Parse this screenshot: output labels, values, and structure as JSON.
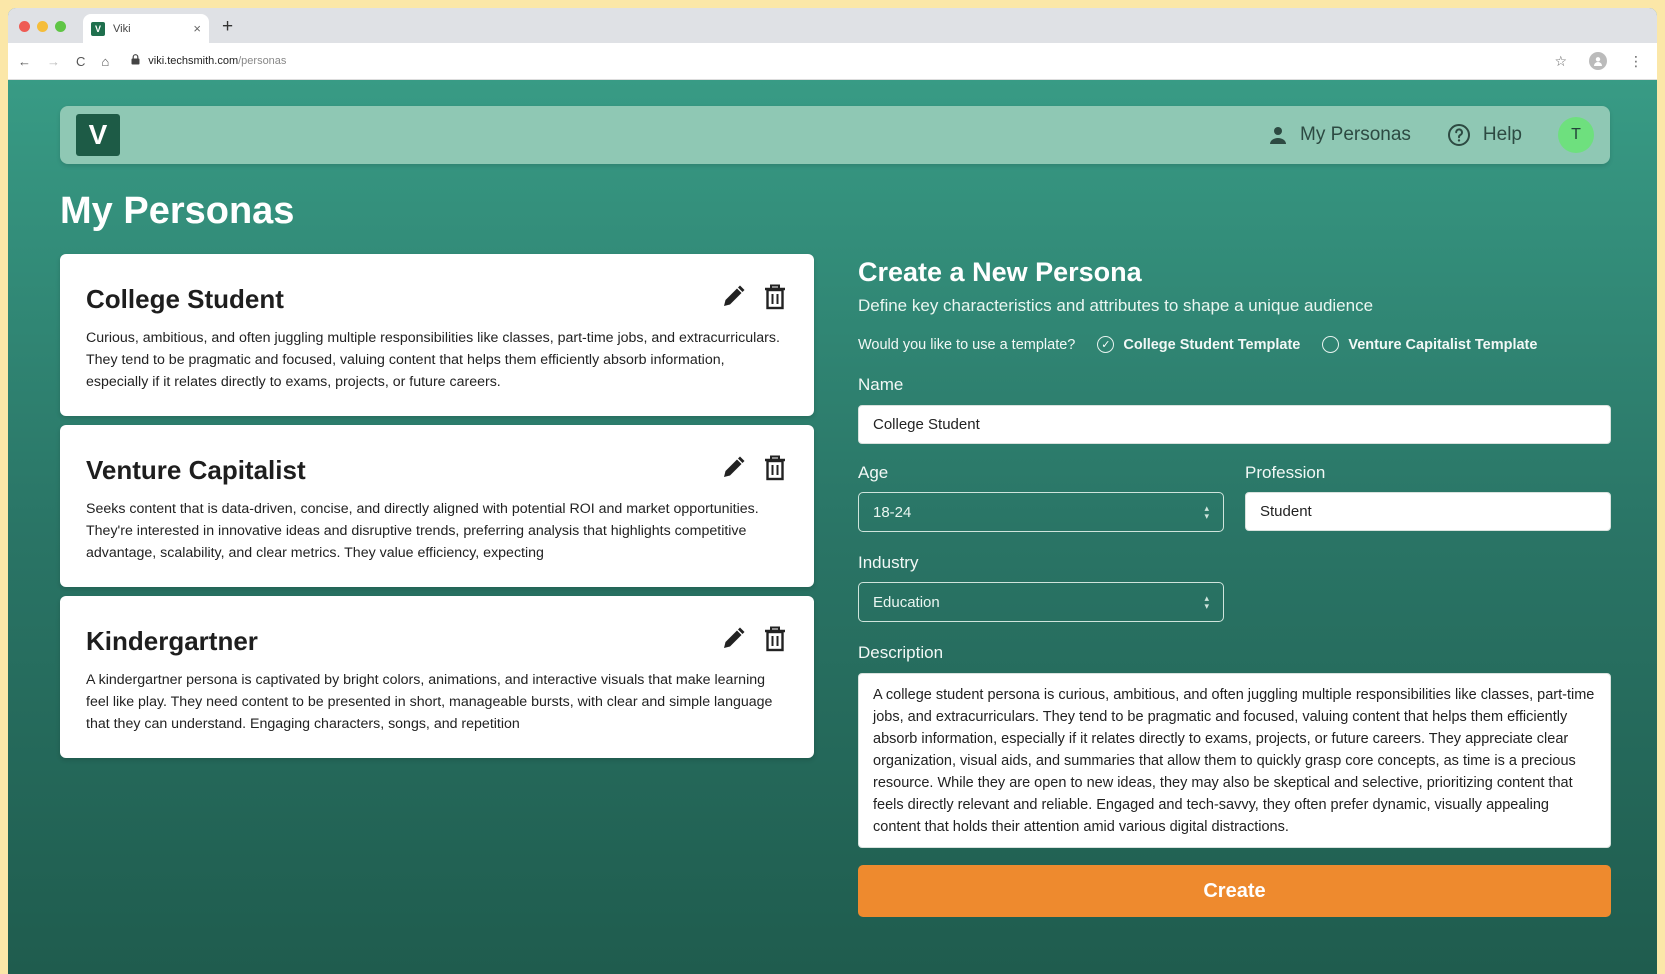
{
  "browser": {
    "tab_title": "Viki",
    "tab_favicon": "V",
    "tab_close": "×",
    "new_tab": "+",
    "url_host": "viki.techsmith.com",
    "url_path": "/personas",
    "nav": {
      "back": "←",
      "forward": "→",
      "reload": "C",
      "home": "⌂"
    },
    "star": "☆",
    "menu": "⋮"
  },
  "app": {
    "logo": "V",
    "nav": {
      "my_personas": "My Personas",
      "help": "Help",
      "avatar_initial": "T"
    },
    "page_title": "My Personas",
    "personas": [
      {
        "title": "College Student",
        "description": "Curious, ambitious, and often juggling multiple responsibilities like classes, part-time jobs, and extracurriculars. They tend to be pragmatic and focused, valuing content that helps them efficiently absorb information, especially if it relates directly to exams, projects, or future careers."
      },
      {
        "title": "Venture Capitalist",
        "description": "Seeks content that is data-driven, concise, and directly aligned with potential ROI and market opportunities. They're interested in innovative ideas and disruptive trends, preferring analysis that highlights competitive advantage, scalability, and clear metrics. They value efficiency, expecting"
      },
      {
        "title": "Kindergartner",
        "description": "A kindergartner persona is captivated by bright colors, animations, and interactive visuals that make learning feel like play. They need content to be presented in short, manageable bursts, with clear and simple language that they can understand. Engaging characters, songs, and repetition"
      }
    ],
    "form": {
      "title": "Create a New Persona",
      "subtitle": "Define key characteristics and attributes to shape a unique audience",
      "template_question": "Would you like to use a template?",
      "template_options": [
        "College Student Template",
        "Venture Capitalist Template"
      ],
      "template_selected": "College Student Template",
      "name_label": "Name",
      "name_value": "College Student",
      "age_label": "Age",
      "age_value": "18-24",
      "profession_label": "Profession",
      "profession_value": "Student",
      "industry_label": "Industry",
      "industry_value": "Education",
      "description_label": "Description",
      "description_value": "A college student persona is curious, ambitious, and often juggling multiple responsibilities like classes, part-time jobs, and extracurriculars. They tend to be pragmatic and focused, valuing content that helps them efficiently absorb information, especially if it relates directly to exams, projects, or future careers. They appreciate clear organization, visual aids, and summaries that allow them to quickly grasp core concepts, as time is a precious resource. While they are open to new ideas, they may also be skeptical and selective, prioritizing content that feels directly relevant and reliable. Engaged and tech-savvy, they often prefer dynamic, visually appealing content that holds their attention amid various digital distractions.",
      "create_label": "Create"
    }
  },
  "colors": {
    "brand": "#1d5b46",
    "accent": "#ee8a2e",
    "avatar": "#6ee07e",
    "navbar": "#8fc8b4",
    "background_top": "#389b85",
    "background_bottom": "#1f5c4e"
  }
}
